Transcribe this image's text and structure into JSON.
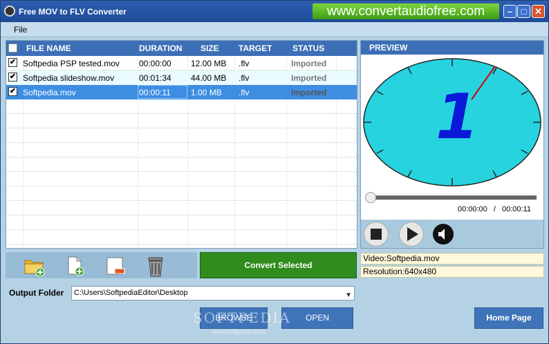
{
  "window": {
    "title": "Free MOV to FLV Converter",
    "banner": "www.convertaudiofree.com",
    "min": "–",
    "max": "□",
    "close": "✕"
  },
  "menu": {
    "file": "File"
  },
  "grid": {
    "headers": [
      "FILE NAME",
      "DURATION",
      "SIZE",
      "TARGET",
      "STATUS"
    ],
    "rows": [
      {
        "name": "Softpedia PSP tested.mov",
        "duration": "00:00:00",
        "size": "12.00 MB",
        "target": ".flv",
        "status": "Imported",
        "checked": "✔"
      },
      {
        "name": "Softpedia slideshow.mov",
        "duration": "00:01:34",
        "size": "44.00 MB",
        "target": ".flv",
        "status": "Imported",
        "checked": "✔"
      },
      {
        "name": "Softpedia.mov",
        "duration": "00:00:11",
        "size": "1.00 MB",
        "target": ".flv",
        "status": "Imported",
        "checked": "✔"
      }
    ]
  },
  "toolbar": {
    "add_folder_icon": "folder-add-icon",
    "add_file_icon": "file-add-icon",
    "remove_icon": "file-remove-icon",
    "trash_icon": "trash-icon"
  },
  "convert_label": "Convert Selected",
  "output": {
    "label": "Output Folder",
    "path": "C:\\Users\\SoftpediaEditor\\Desktop"
  },
  "buttons": {
    "browse": "BROWSE",
    "open": "OPEN",
    "home": "Home Page"
  },
  "preview": {
    "title": "PREVIEW",
    "current_time": "00:00:00",
    "separator": "/",
    "total_time": "00:00:11",
    "video": "Video:Softpedia.mov",
    "resolution": "Resolution:640x480",
    "frame_digit": "1",
    "seek_position": 0
  },
  "watermark": {
    "text": "SOFTPEDIA",
    "url": "www.softpedia.com"
  },
  "colors": {
    "header_blue": "#3c6fb6",
    "convert_green": "#2f8c1d",
    "clock_face": "#26d3df"
  }
}
